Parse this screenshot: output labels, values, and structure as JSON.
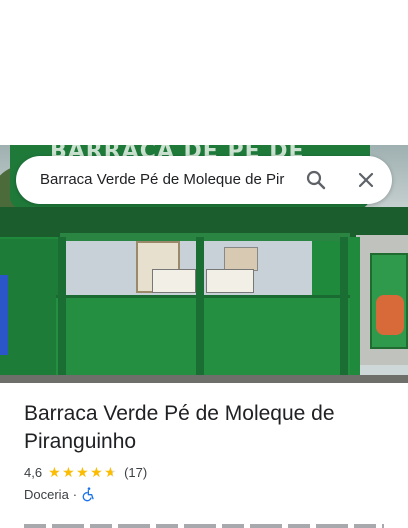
{
  "search": {
    "query": "Barraca Verde Pé de Moleque de Pir",
    "search_icon": "search-icon",
    "close_icon": "close-icon"
  },
  "photo": {
    "banner_text": "BARRACA DE PÉ DE MOLEQUE"
  },
  "place": {
    "name": "Barraca Verde Pé de Moleque de Piranguinho",
    "rating": "4,6",
    "stars": 4.6,
    "reviews": "(17)",
    "category": "Doceria",
    "separator": "·",
    "accessibility_icon": "wheelchair-icon"
  },
  "colors": {
    "star": "#fbbc04",
    "accessibility": "#1a73e8",
    "text": "#202124"
  }
}
